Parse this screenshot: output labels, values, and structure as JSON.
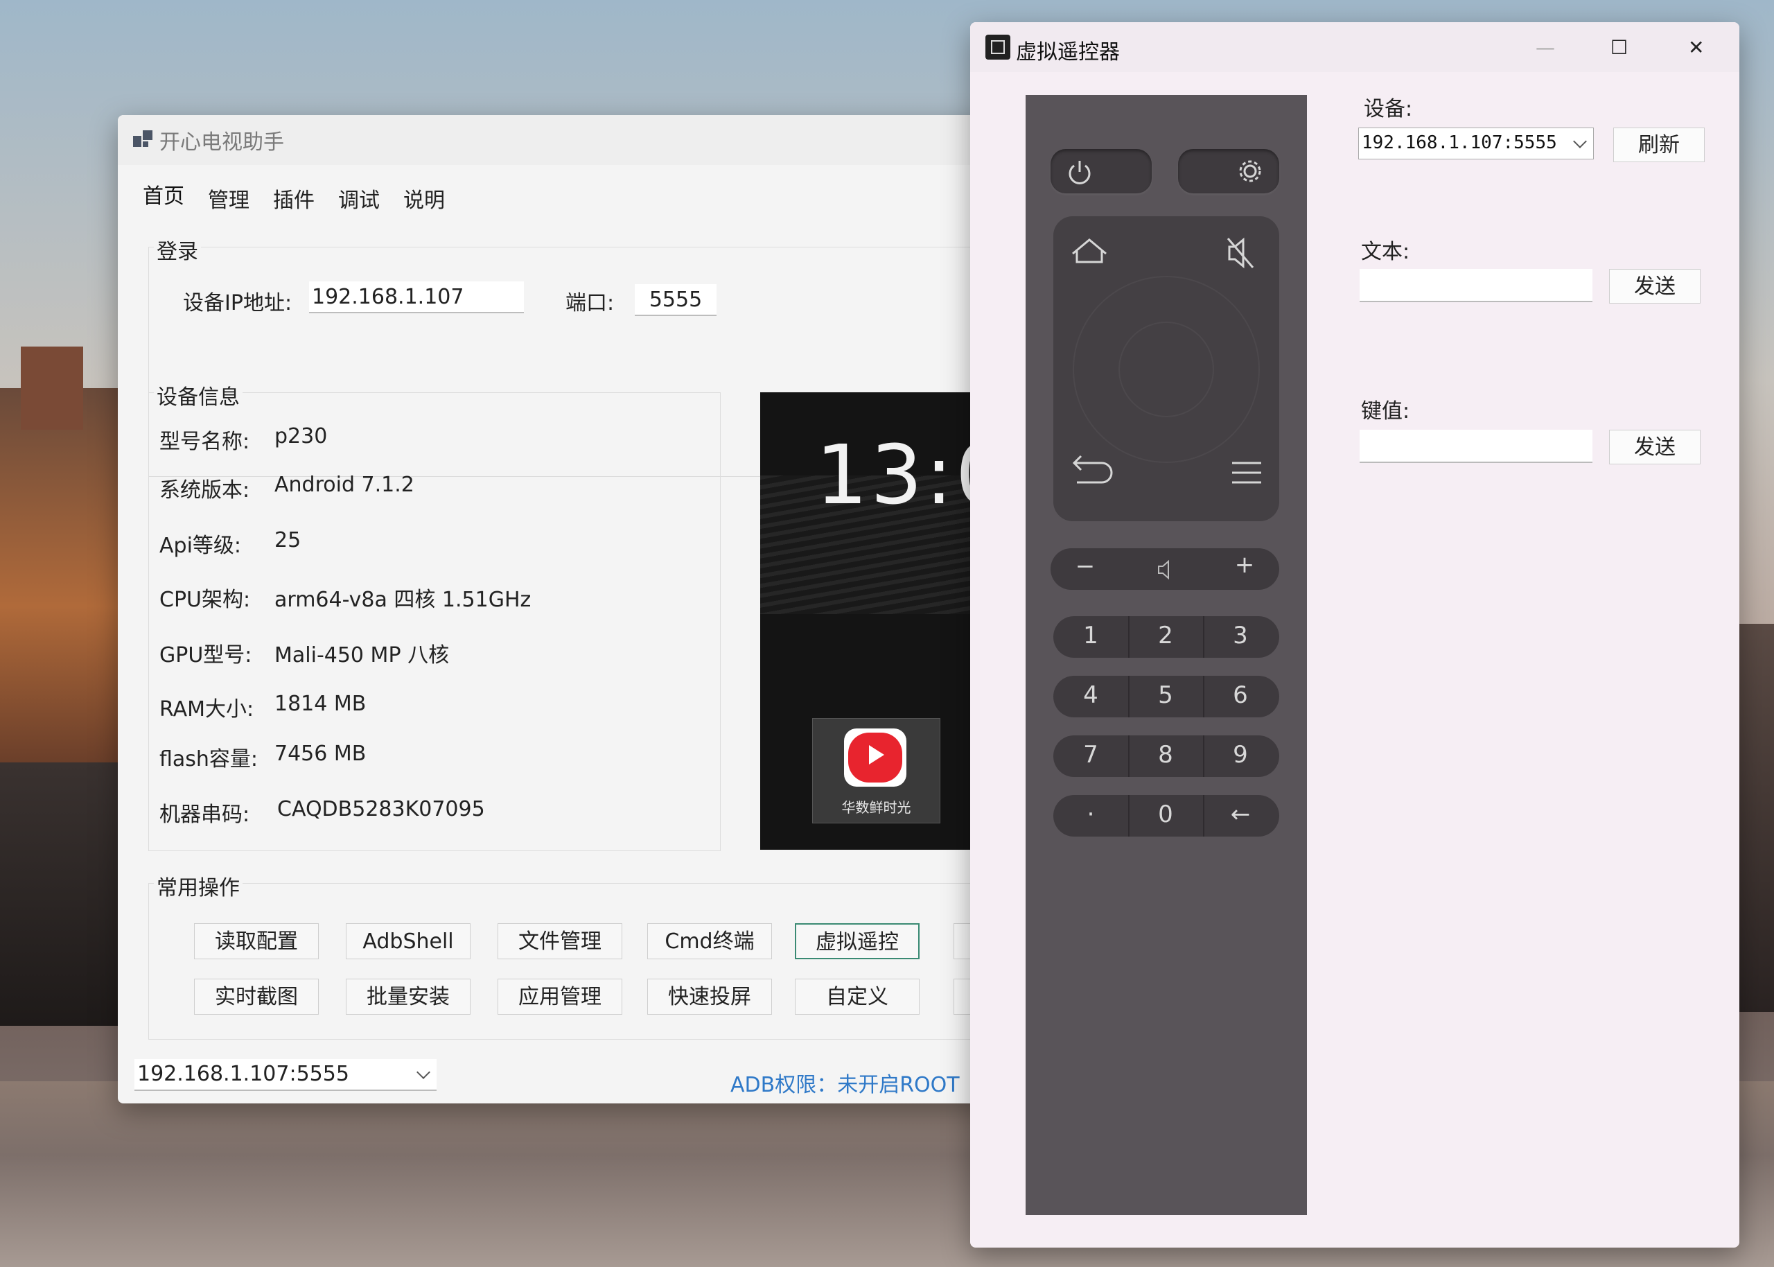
{
  "main_window": {
    "title": "开心电视助手",
    "menu": [
      "首页",
      "管理",
      "插件",
      "调试",
      "说明"
    ],
    "login": {
      "group_title": "登录",
      "ip_label": "设备IP地址:",
      "ip_value": "192.168.1.107",
      "port_label": "端口:",
      "port_value": "5555"
    },
    "device_info": {
      "group_title": "设备信息",
      "rows": [
        {
          "label": "型号名称:",
          "value": "p230"
        },
        {
          "label": "系统版本:",
          "value": "Android 7.1.2"
        },
        {
          "label": "Api等级:",
          "value": "25"
        },
        {
          "label": "CPU架构:",
          "value": "arm64-v8a 四核 1.51GHz"
        },
        {
          "label": "GPU型号:",
          "value": "Mali-450 MP 八核"
        },
        {
          "label": "RAM大小:",
          "value": "1814 MB"
        },
        {
          "label": "flash容量:",
          "value": "7456 MB"
        },
        {
          "label": "机器串码:",
          "value": "CAQDB5283K07095"
        }
      ]
    },
    "preview": {
      "clock": "13:0",
      "app_name": "华数鲜时光"
    },
    "operations": {
      "group_title": "常用操作",
      "row1": [
        "读取配置",
        "AdbShell",
        "文件管理",
        "Cmd终端",
        "虚拟遥控"
      ],
      "row2": [
        "实时截图",
        "批量安装",
        "应用管理",
        "快速投屏",
        "自定义"
      ]
    },
    "status": {
      "device": "192.168.1.107:5555",
      "adb_permission": "ADB权限：未开启ROOT"
    }
  },
  "remote_window": {
    "title": "虚拟遥控器",
    "controls": {
      "minimize": "—",
      "maximize": "☐",
      "close": "✕"
    },
    "device_label": "设备:",
    "device_value": "192.168.1.107:5555",
    "refresh_button": "刷新",
    "text_label": "文本:",
    "text_value": "",
    "send_text_button": "发送",
    "key_label": "键值:",
    "key_value": "",
    "send_key_button": "发送",
    "remote": {
      "volume": {
        "minus": "−",
        "plus": "+"
      },
      "numpad": [
        [
          "1",
          "2",
          "3"
        ],
        [
          "4",
          "5",
          "6"
        ],
        [
          "7",
          "8",
          "9"
        ],
        [
          "·",
          "0",
          "←"
        ]
      ]
    }
  }
}
